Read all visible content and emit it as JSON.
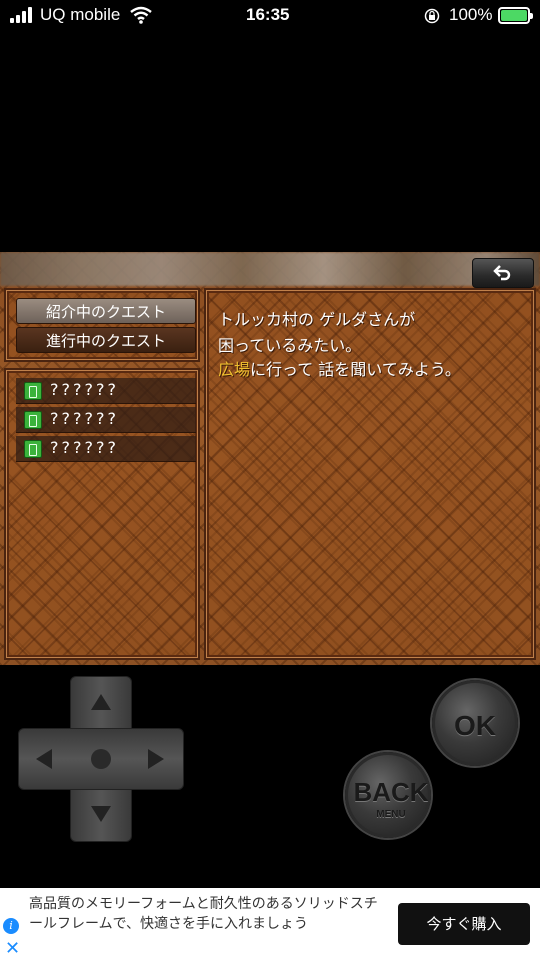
{
  "status_bar": {
    "carrier": "UQ mobile",
    "time": "16:35",
    "battery": "100%",
    "battery_color": "#4cd964"
  },
  "game": {
    "back_icon": "return-arrow-icon",
    "tabs": [
      {
        "label": "紹介中のクエスト",
        "active": true
      },
      {
        "label": "進行中のクエスト",
        "active": false
      }
    ],
    "quests": [
      {
        "label": "??????",
        "icon": "book-icon"
      },
      {
        "label": "??????",
        "icon": "book-icon"
      },
      {
        "label": "??????",
        "icon": "book-icon"
      }
    ],
    "message": {
      "line1": "トルッカ村の ゲルダさんが",
      "line2": "困っているみたい。",
      "line3_highlight": "広場",
      "line3_rest": "に行って 話を聞いてみよう。",
      "highlight_color": "#f0c030"
    }
  },
  "controller": {
    "ok_label": "OK",
    "back_label": "BACK",
    "back_sub_label": "MENU"
  },
  "ad": {
    "text": "高品質のメモリーフォームと耐久性のあるソリッドスチールフレームで、快適さを手に入れましょう",
    "cta": "今すぐ購入",
    "info_icon": "info-icon",
    "close_icon": "close-icon"
  }
}
